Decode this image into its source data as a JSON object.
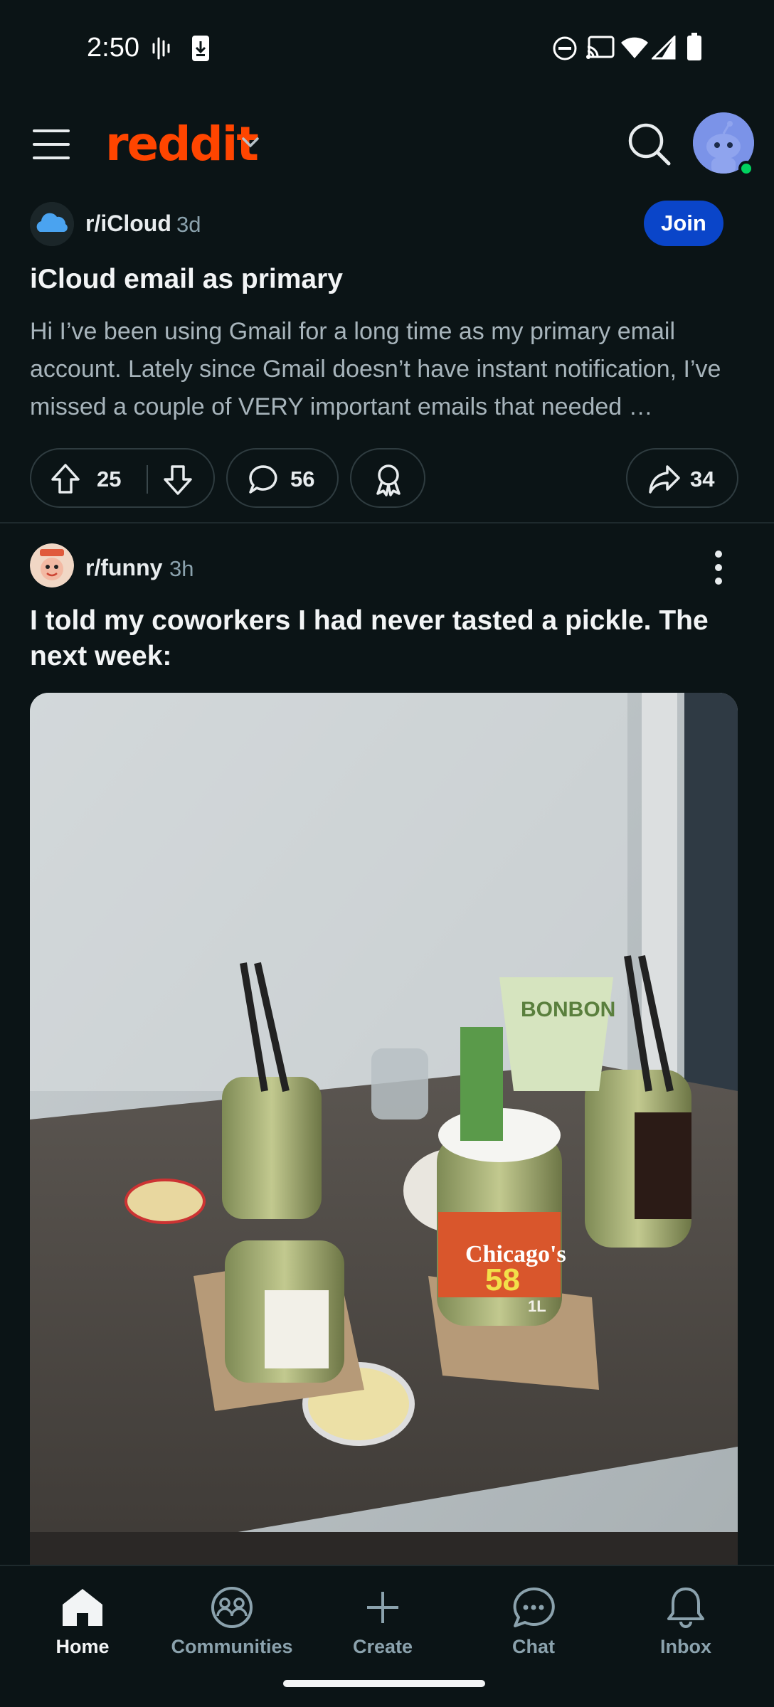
{
  "status_bar": {
    "time": "2:50",
    "icons": [
      "voicemail-wave-icon",
      "download-icon",
      "do-not-disturb-icon",
      "cast-icon",
      "wifi-icon",
      "signal-icon",
      "battery-icon"
    ]
  },
  "header": {
    "brand": "reddit",
    "brand_color": "#ff4500",
    "icons": [
      "menu-icon",
      "chevron-down-icon",
      "search-icon",
      "avatar"
    ]
  },
  "posts": [
    {
      "subreddit": "r/iCloud",
      "age": "3d",
      "join_label": "Join",
      "title": "iCloud email as primary",
      "body": "Hi I’ve been using Gmail for a long time as my primary email account. Lately since Gmail doesn’t have instant notification, I’ve missed a couple of VERY important emails that needed …",
      "upvotes": "25",
      "comments": "56",
      "shares": "34"
    },
    {
      "subreddit": "r/funny",
      "age": "3h",
      "title": "I told my coworkers I had never tasted a pickle. The next week:",
      "image_alt": "Several jars of pickles with tongs on an office table",
      "image_texts": [
        "BONBON",
        "Chicago's",
        "58",
        "1L"
      ]
    }
  ],
  "bottom_nav": {
    "items": [
      {
        "label": "Home",
        "icon": "home-icon",
        "active": true
      },
      {
        "label": "Communities",
        "icon": "communities-icon",
        "active": false
      },
      {
        "label": "Create",
        "icon": "plus-icon",
        "active": false
      },
      {
        "label": "Chat",
        "icon": "chat-icon",
        "active": false
      },
      {
        "label": "Inbox",
        "icon": "bell-icon",
        "active": false
      }
    ]
  },
  "colors": {
    "background": "#0b1416",
    "join_button": "#0a45c9",
    "online_dot": "#01d35f"
  }
}
